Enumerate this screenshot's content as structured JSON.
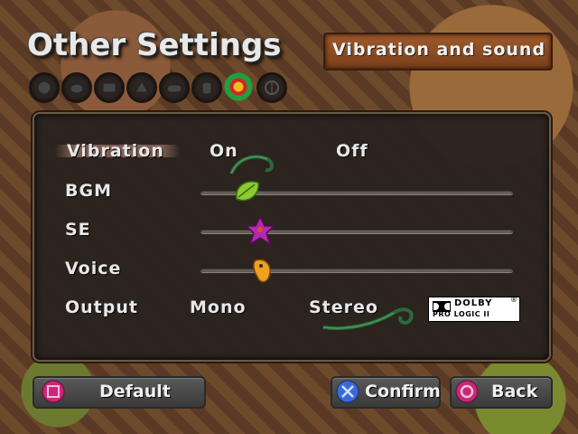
{
  "header": {
    "title": "Other Settings",
    "subtitle": "Vibration and sound"
  },
  "tabs": [
    {
      "icon": "monster-icon"
    },
    {
      "icon": "pet-icon"
    },
    {
      "icon": "book-icon"
    },
    {
      "icon": "map-icon"
    },
    {
      "icon": "gamepad-icon"
    },
    {
      "icon": "hand-icon"
    },
    {
      "icon": "flower-icon",
      "active": true
    },
    {
      "icon": "save-icon"
    }
  ],
  "settings": {
    "vibration": {
      "label": "Vibration",
      "options": [
        "On",
        "Off"
      ],
      "selected": "On"
    },
    "bgm": {
      "label": "BGM",
      "level": 0.15
    },
    "se": {
      "label": "SE",
      "level": 0.19
    },
    "voice": {
      "label": "Voice",
      "level": 0.2
    },
    "output": {
      "label": "Output",
      "options": [
        "Mono",
        "Stereo"
      ],
      "selected": "Stereo"
    }
  },
  "dolby": {
    "line1": "DOLBY",
    "line2": "PRO LOGIC II",
    "reg": "®"
  },
  "footer": {
    "default_label": "Default",
    "confirm_label": "Confirm",
    "back_label": "Back"
  },
  "colors": {
    "panel": "#2a221e",
    "text": "#e8e8e8",
    "highlight": "#a0786e",
    "button": "#4a4a4a"
  }
}
